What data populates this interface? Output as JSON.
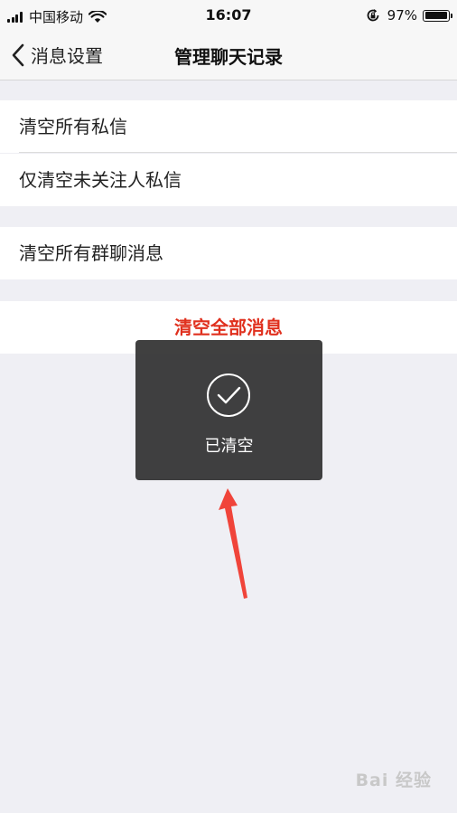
{
  "status_bar": {
    "carrier": "中国移动",
    "time": "16:07",
    "battery_percent": "97%",
    "battery_level": 0.97
  },
  "nav": {
    "back_label": "消息设置",
    "title": "管理聊天记录"
  },
  "sections": {
    "clear_all_private": "清空所有私信",
    "clear_unfollowed_private": "仅清空未关注人私信",
    "clear_all_group": "清空所有群聊消息",
    "clear_all_messages": "清空全部消息"
  },
  "toast": {
    "message": "已清空"
  },
  "watermark": "Bai 经验",
  "colors": {
    "danger": "#e0301e",
    "arrow": "#f0443a",
    "background": "#efeff4"
  }
}
